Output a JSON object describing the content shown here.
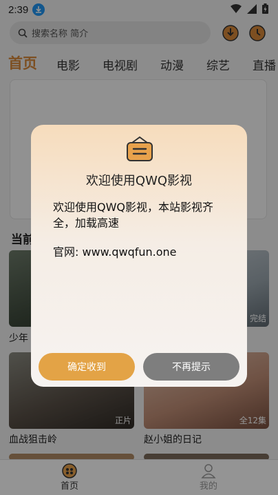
{
  "status_bar": {
    "time": "2:39"
  },
  "search": {
    "placeholder": "搜索名称 简介"
  },
  "tabs": [
    {
      "label": "首页"
    },
    {
      "label": "电影"
    },
    {
      "label": "电视剧"
    },
    {
      "label": "动漫"
    },
    {
      "label": "综艺"
    },
    {
      "label": "直播"
    }
  ],
  "section": {
    "title": "当前"
  },
  "cards": [
    {
      "title": "少年",
      "badge": ""
    },
    {
      "title": "",
      "badge": "完结"
    },
    {
      "title": "血战狙击岭",
      "badge": "正片"
    },
    {
      "title": "赵小姐的日记",
      "badge": "全12集"
    }
  ],
  "bottom_nav": [
    {
      "label": "首页"
    },
    {
      "label": "我的"
    }
  ],
  "dialog": {
    "title": "欢迎使用QWQ影视",
    "message": "欢迎使用QWQ影视，本站影视齐全，加载高速",
    "site": "官网: www.qwqfun.one",
    "confirm_label": "确定收到",
    "dismiss_label": "不再提示"
  },
  "colors": {
    "accent": "#d7893a",
    "confirm_button": "#e3a346",
    "dismiss_button": "#7e7e7e",
    "status_download": "#2196f3"
  }
}
